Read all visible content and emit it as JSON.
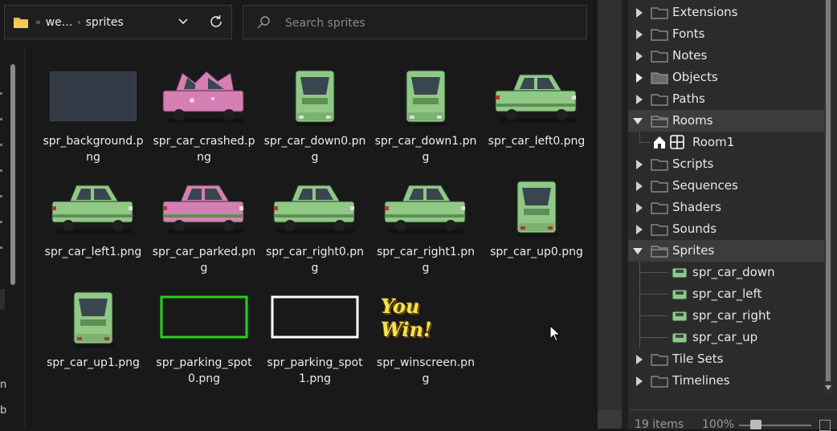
{
  "explorer": {
    "breadcrumb": [
      "we...",
      "sprites"
    ],
    "search_placeholder": "Search sprites",
    "files": [
      {
        "name": "spr_background.png",
        "kind": "background"
      },
      {
        "name": "spr_car_crashed.png",
        "kind": "car-crashed"
      },
      {
        "name": "spr_car_down0.png",
        "kind": "car-vertical"
      },
      {
        "name": "spr_car_down1.png",
        "kind": "car-vertical"
      },
      {
        "name": "spr_car_left0.png",
        "kind": "car-side"
      },
      {
        "name": "spr_car_left1.png",
        "kind": "car-side"
      },
      {
        "name": "spr_car_parked.png",
        "kind": "car-parked"
      },
      {
        "name": "spr_car_right0.png",
        "kind": "car-side"
      },
      {
        "name": "spr_car_right1.png",
        "kind": "car-side"
      },
      {
        "name": "spr_car_up0.png",
        "kind": "car-vertical-up"
      },
      {
        "name": "spr_car_up1.png",
        "kind": "car-vertical-up"
      },
      {
        "name": "spr_parking_spot0.png",
        "kind": "spot-green"
      },
      {
        "name": "spr_parking_spot1.png",
        "kind": "spot-white"
      },
      {
        "name": "spr_winscreen.png",
        "kind": "winscreen",
        "thumb_text": "You Win!"
      }
    ],
    "nav_letters": [
      "n",
      "b"
    ]
  },
  "assets": {
    "tree": [
      {
        "label": "Extensions",
        "state": "collapsed"
      },
      {
        "label": "Fonts",
        "state": "collapsed"
      },
      {
        "label": "Notes",
        "state": "collapsed"
      },
      {
        "label": "Objects",
        "state": "collapsed-bold"
      },
      {
        "label": "Paths",
        "state": "collapsed"
      },
      {
        "label": "Rooms",
        "state": "expanded"
      },
      {
        "label": "Room1",
        "state": "room-child"
      },
      {
        "label": "Scripts",
        "state": "collapsed"
      },
      {
        "label": "Sequences",
        "state": "collapsed"
      },
      {
        "label": "Shaders",
        "state": "collapsed"
      },
      {
        "label": "Sounds",
        "state": "collapsed"
      },
      {
        "label": "Sprites",
        "state": "expanded"
      },
      {
        "label": "spr_car_down",
        "state": "sprite-child"
      },
      {
        "label": "spr_car_left",
        "state": "sprite-child"
      },
      {
        "label": "spr_car_right",
        "state": "sprite-child"
      },
      {
        "label": "spr_car_up",
        "state": "sprite-child"
      },
      {
        "label": "Tile Sets",
        "state": "collapsed"
      },
      {
        "label": "Timelines",
        "state": "collapsed"
      }
    ],
    "status": {
      "count": "19 items",
      "zoom": "100%"
    }
  },
  "colors": {
    "car_green": "#8fc985",
    "car_pink": "#d67fb4",
    "spot_green": "#22d41c",
    "win_yellow": "#f1e44b"
  }
}
